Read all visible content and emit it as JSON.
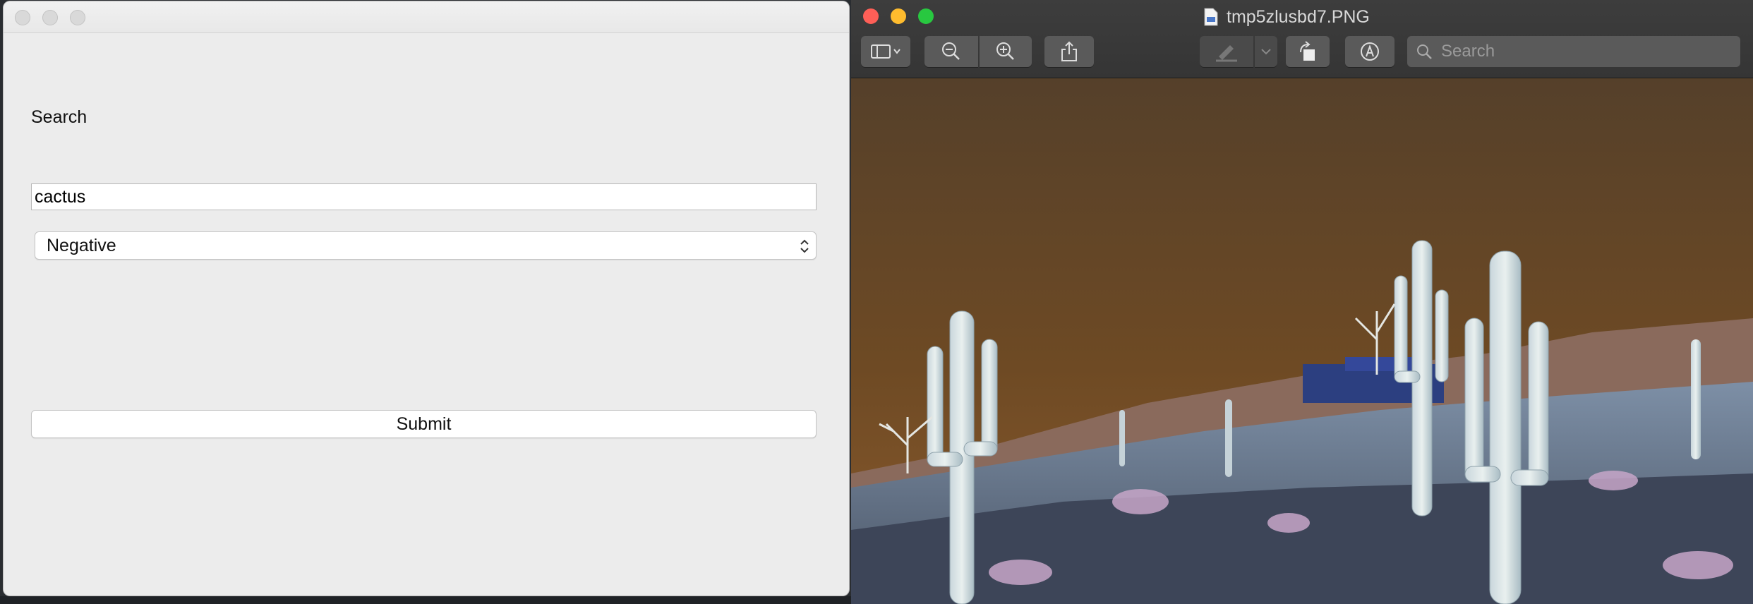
{
  "form_window": {
    "search_label": "Search",
    "search_input_value": "cactus",
    "filter_select": {
      "selected": "Negative"
    },
    "submit_label": "Submit"
  },
  "preview_window": {
    "title": "tmp5zlusbd7.PNG",
    "toolbar": {
      "search_placeholder": "Search",
      "buttons": [
        "sidebar-icon",
        "zoom-out-icon",
        "zoom-in-icon",
        "share-icon",
        "highlight-icon",
        "rotate-icon",
        "markup-icon"
      ]
    },
    "image": {
      "description_colors": {
        "sky_top": "#5a3e1f",
        "sky_bottom": "#7a4e22",
        "ground": "#5b6d86"
      }
    }
  }
}
